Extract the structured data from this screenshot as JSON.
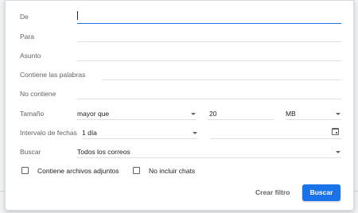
{
  "labels": {
    "from": "De",
    "to": "Para",
    "subject": "Asunto",
    "has_words": "Contiene las palabras",
    "doesnt_have": "No contiene",
    "size": "Tamaño",
    "date_within": "Intervalo de fechas",
    "search": "Buscar"
  },
  "fields": {
    "from_value": "",
    "to_value": "",
    "subject_value": "",
    "has_words_value": "",
    "doesnt_have_value": ""
  },
  "size": {
    "operator": "mayor que",
    "amount": "20",
    "unit": "MB"
  },
  "date_within": {
    "range": "1 día",
    "date": ""
  },
  "search_in": {
    "value": "Todos los correos"
  },
  "checkboxes": {
    "has_attachment": "Contiene archivos adjuntos",
    "no_chats": "No incluir chats"
  },
  "actions": {
    "create_filter": "Crear filtro",
    "search": "Buscar"
  },
  "colors": {
    "accent": "#1a73e8",
    "label": "#5f6368",
    "text": "#202124"
  },
  "icons": {
    "dropdown": "chevron-down-icon",
    "calendar": "calendar-icon",
    "checkbox": "checkbox-icon"
  }
}
